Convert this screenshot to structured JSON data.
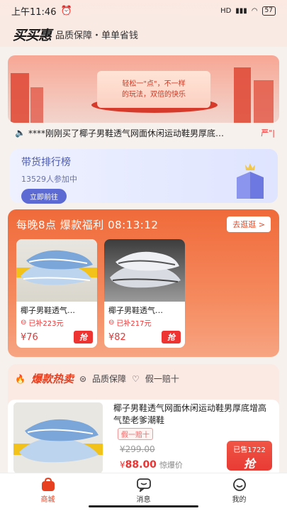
{
  "status": {
    "time": "上午11:46",
    "network": "HD",
    "battery": "57"
  },
  "header": {
    "logo": "买买惠",
    "slogan": "品质保障・单单省钱"
  },
  "banner": {
    "line1": "轻松一\"点\"，不一样",
    "line2": "的玩法，双倍的快乐"
  },
  "ticker": {
    "text": "****刚刚买了椰子男鞋透气网面休闲运动鞋男厚底…",
    "tail": "严\"|"
  },
  "ranking": {
    "title": "带货排行榜",
    "participants": "13529人参加中",
    "button": "立即前往"
  },
  "flash_sale": {
    "title": "每晚8点  爆款福利  08:13:12",
    "go": "去逛逛 >",
    "products": [
      {
        "name": "椰子男鞋透气…",
        "subsidy": "已补223元",
        "price": "¥76",
        "buy": "抢"
      },
      {
        "name": "椰子男鞋透气…",
        "subsidy": "已补217元",
        "price": "¥82",
        "buy": "抢"
      }
    ]
  },
  "hot": {
    "title": "爆款热卖",
    "badge1": "品质保障",
    "badge2": "假一赔十",
    "item": {
      "name": "椰子男鞋透气网面休闲运动鞋男厚底增高气垫老爹潮鞋",
      "tag": "假一赔十",
      "orig": "¥299.00",
      "currency": "¥",
      "price": "88.00",
      "price_note": "惊爆价",
      "sold": "已售1722",
      "buy": "抢"
    }
  },
  "tabbar": {
    "home": "商城",
    "msg": "消息",
    "me": "我的"
  },
  "colors": {
    "accent": "#e64020",
    "rank": "#5c6ad4"
  }
}
